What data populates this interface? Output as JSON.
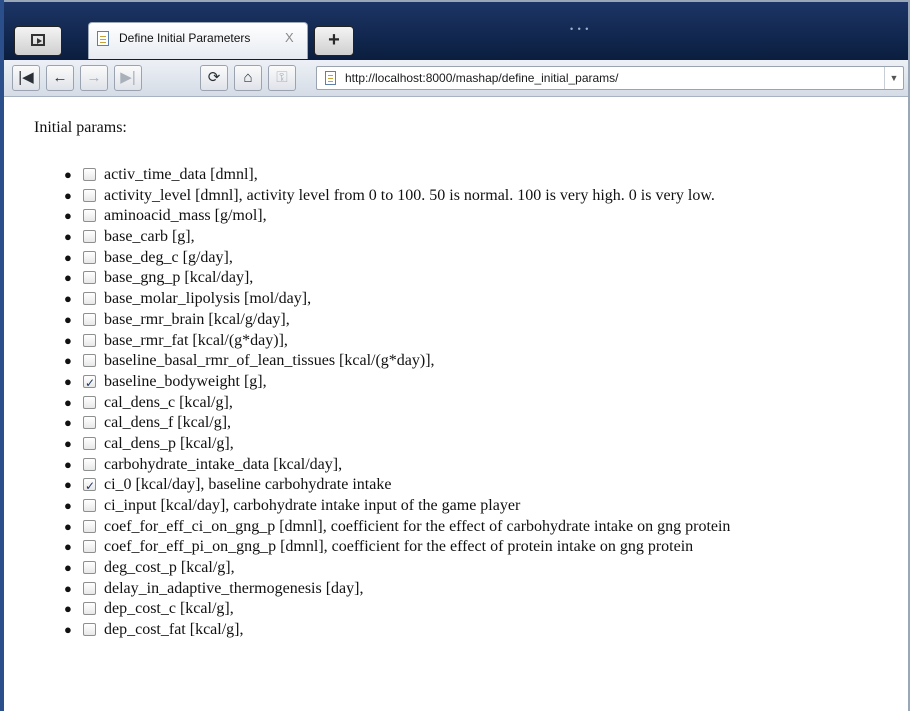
{
  "browser": {
    "tab_title": "Define Initial Parameters",
    "tab_close": "X",
    "new_tab": "+",
    "url": "http://localhost:8000/mashap/define_initial_params/"
  },
  "icons": {
    "sidebar": "sidebar-toggle-icon",
    "tab_page": "page-icon",
    "new_tab": "plus-icon",
    "nav": [
      "skip-back-icon",
      "back-icon",
      "forward-icon",
      "skip-forward-icon",
      "reload-icon",
      "home-icon",
      "key-icon"
    ]
  },
  "page": {
    "heading": "Initial params:",
    "params": [
      {
        "label": "activ_time_data [dmnl],",
        "checked": false
      },
      {
        "label": "activity_level [dmnl], activity level from 0 to 100. 50 is normal. 100 is very high. 0 is very low.",
        "checked": false
      },
      {
        "label": "aminoacid_mass [g/mol],",
        "checked": false
      },
      {
        "label": "base_carb [g],",
        "checked": false
      },
      {
        "label": "base_deg_c [g/day],",
        "checked": false
      },
      {
        "label": "base_gng_p [kcal/day],",
        "checked": false
      },
      {
        "label": "base_molar_lipolysis [mol/day],",
        "checked": false
      },
      {
        "label": "base_rmr_brain [kcal/g/day],",
        "checked": false
      },
      {
        "label": "base_rmr_fat [kcal/(g*day)],",
        "checked": false
      },
      {
        "label": "baseline_basal_rmr_of_lean_tissues [kcal/(g*day)],",
        "checked": false
      },
      {
        "label": "baseline_bodyweight [g],",
        "checked": true
      },
      {
        "label": "cal_dens_c [kcal/g],",
        "checked": false
      },
      {
        "label": "cal_dens_f [kcal/g],",
        "checked": false
      },
      {
        "label": "cal_dens_p [kcal/g],",
        "checked": false
      },
      {
        "label": "carbohydrate_intake_data [kcal/day],",
        "checked": false
      },
      {
        "label": "ci_0 [kcal/day], baseline carbohydrate intake",
        "checked": true
      },
      {
        "label": "ci_input [kcal/day], carbohydrate intake input of the game player",
        "checked": false
      },
      {
        "label": "coef_for_eff_ci_on_gng_p [dmnl], coefficient for the effect of carbohydrate intake on gng protein",
        "checked": false
      },
      {
        "label": "coef_for_eff_pi_on_gng_p [dmnl], coefficient for the effect of protein intake on gng protein",
        "checked": false
      },
      {
        "label": "deg_cost_p [kcal/g],",
        "checked": false
      },
      {
        "label": "delay_in_adaptive_thermogenesis [day],",
        "checked": false
      },
      {
        "label": "dep_cost_c [kcal/g],",
        "checked": false
      },
      {
        "label": "dep_cost_fat [kcal/g],",
        "checked": false
      }
    ]
  }
}
